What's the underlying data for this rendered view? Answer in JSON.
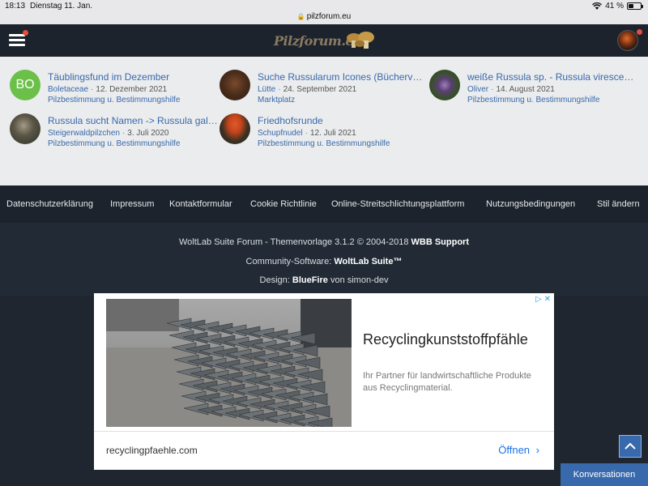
{
  "status_bar": {
    "time": "18:13",
    "date": "Dienstag 11. Jan.",
    "url": "pilzforum.eu",
    "battery": "41 %",
    "battery_level": 0.41
  },
  "header": {
    "logo_text": "Pilzforum.eu"
  },
  "threads": [
    {
      "title": "Täublingsfund im Dezember",
      "user": "Boletaceae",
      "date": "12. Dezember 2021",
      "board": "Pilzbestimmung u. Bestimmungshilfe",
      "avatar_initials": "BO"
    },
    {
      "title": "Suche Russularum Icones (Bücherver…",
      "user": "Lütte",
      "date": "24. September 2021",
      "board": "Marktplatz"
    },
    {
      "title": "weiße Russula sp. - Russula virescens…",
      "user": "Oliver",
      "date": "14. August 2021",
      "board": "Pilzbestimmung u. Bestimmungshilfe"
    },
    {
      "title": "Russula sucht Namen -> Russula galo…",
      "user": "Steigerwaldpilzchen",
      "date": "3. Juli 2020",
      "board": "Pilzbestimmung u. Bestimmungshilfe"
    },
    {
      "title": "Friedhofsrunde",
      "user": "Schupfnudel",
      "date": "12. Juli 2021",
      "board": "Pilzbestimmung u. Bestimmungshilfe"
    }
  ],
  "footer_nav": [
    "Datenschutzerklärung",
    "Impressum",
    "Kontaktformular",
    "Cookie Richtlinie",
    "Online-Streitschlichtungsplattform",
    "Nutzungsbedingungen",
    "Stil ändern"
  ],
  "copyright": {
    "line1_prefix": "WoltLab Suite Forum - Themenvorlage 3.1.2 © 2004-2018 ",
    "line1_bold": "WBB Support",
    "line2_prefix": "Community-Software: ",
    "line2_bold": "WoltLab Suite™",
    "line3_prefix": "Design: ",
    "line3_bold": "BlueFire",
    "line3_suffix": " von simon-dev"
  },
  "ad": {
    "headline": "Recyclingkunststoffpfähle",
    "description": "Ihr Partner für landwirtschaftliche Produkte aus Recyclingmaterial.",
    "domain": "recyclingpfaehle.com",
    "cta": "Öffnen",
    "adchoices": "▷ ✕"
  },
  "buttons": {
    "conversations": "Konversationen"
  },
  "colors": {
    "link": "#3869ad",
    "header_bg": "#1c232d",
    "content_bg": "#ebeced"
  }
}
